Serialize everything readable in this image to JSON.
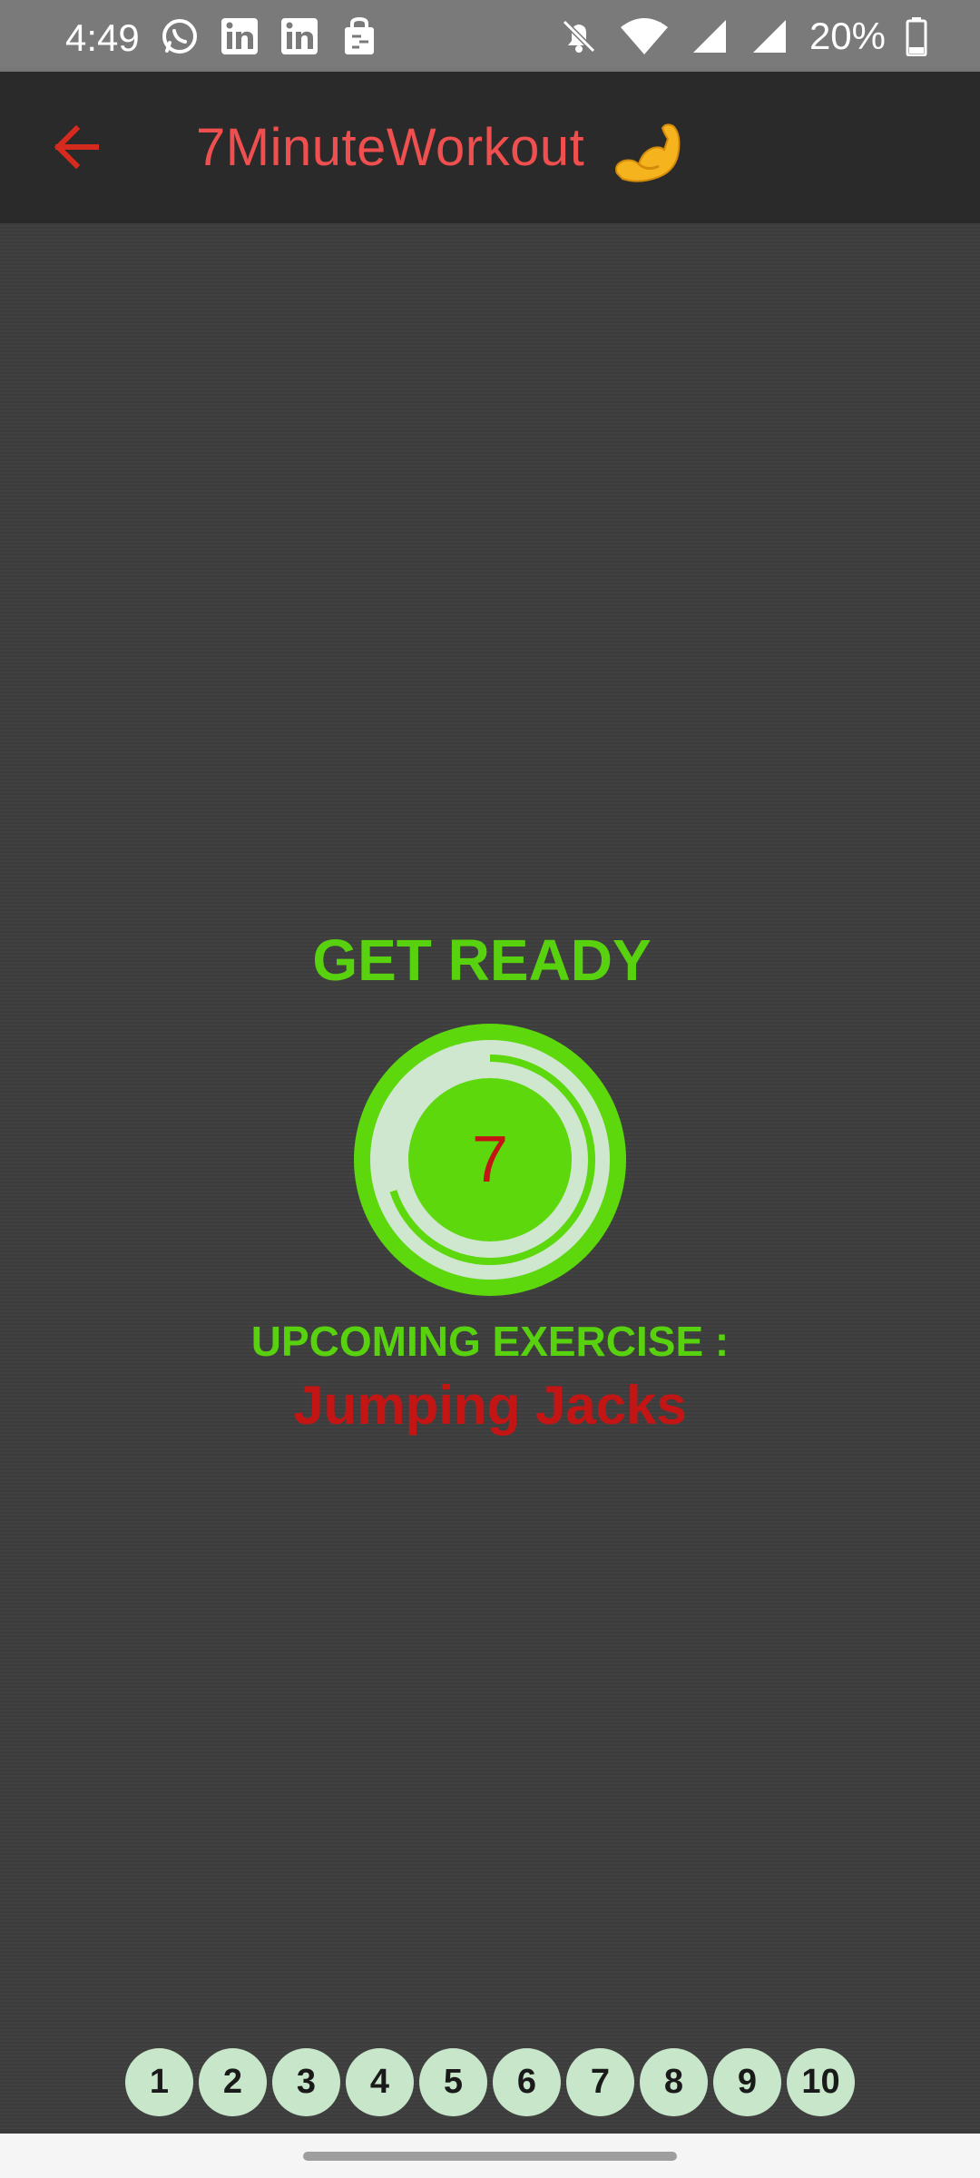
{
  "status_bar": {
    "time": "4:49",
    "battery": "20%",
    "left_icons": [
      "whatsapp-icon",
      "linkedin-icon",
      "linkedin-icon",
      "bag-icon"
    ],
    "right_icons": [
      "mute-icon",
      "wifi-icon",
      "signal-icon",
      "signal-icon",
      "battery-icon"
    ]
  },
  "app_bar": {
    "title": "7MinuteWorkout",
    "title_icon": "flexed-biceps-icon",
    "back_icon": "arrow-back-icon",
    "title_color": "#ef4f4f"
  },
  "main": {
    "heading": "GET READY",
    "timer_value": "7",
    "timer_progress": 0.7,
    "upcoming_label": "UPCOMING EXERCISE :",
    "exercise_name": "Jumping Jacks",
    "accent_green": "#58d10e",
    "accent_red": "#c41515"
  },
  "progress": {
    "items": [
      "1",
      "2",
      "3",
      "4",
      "5",
      "6",
      "7",
      "8",
      "9",
      "10"
    ]
  }
}
